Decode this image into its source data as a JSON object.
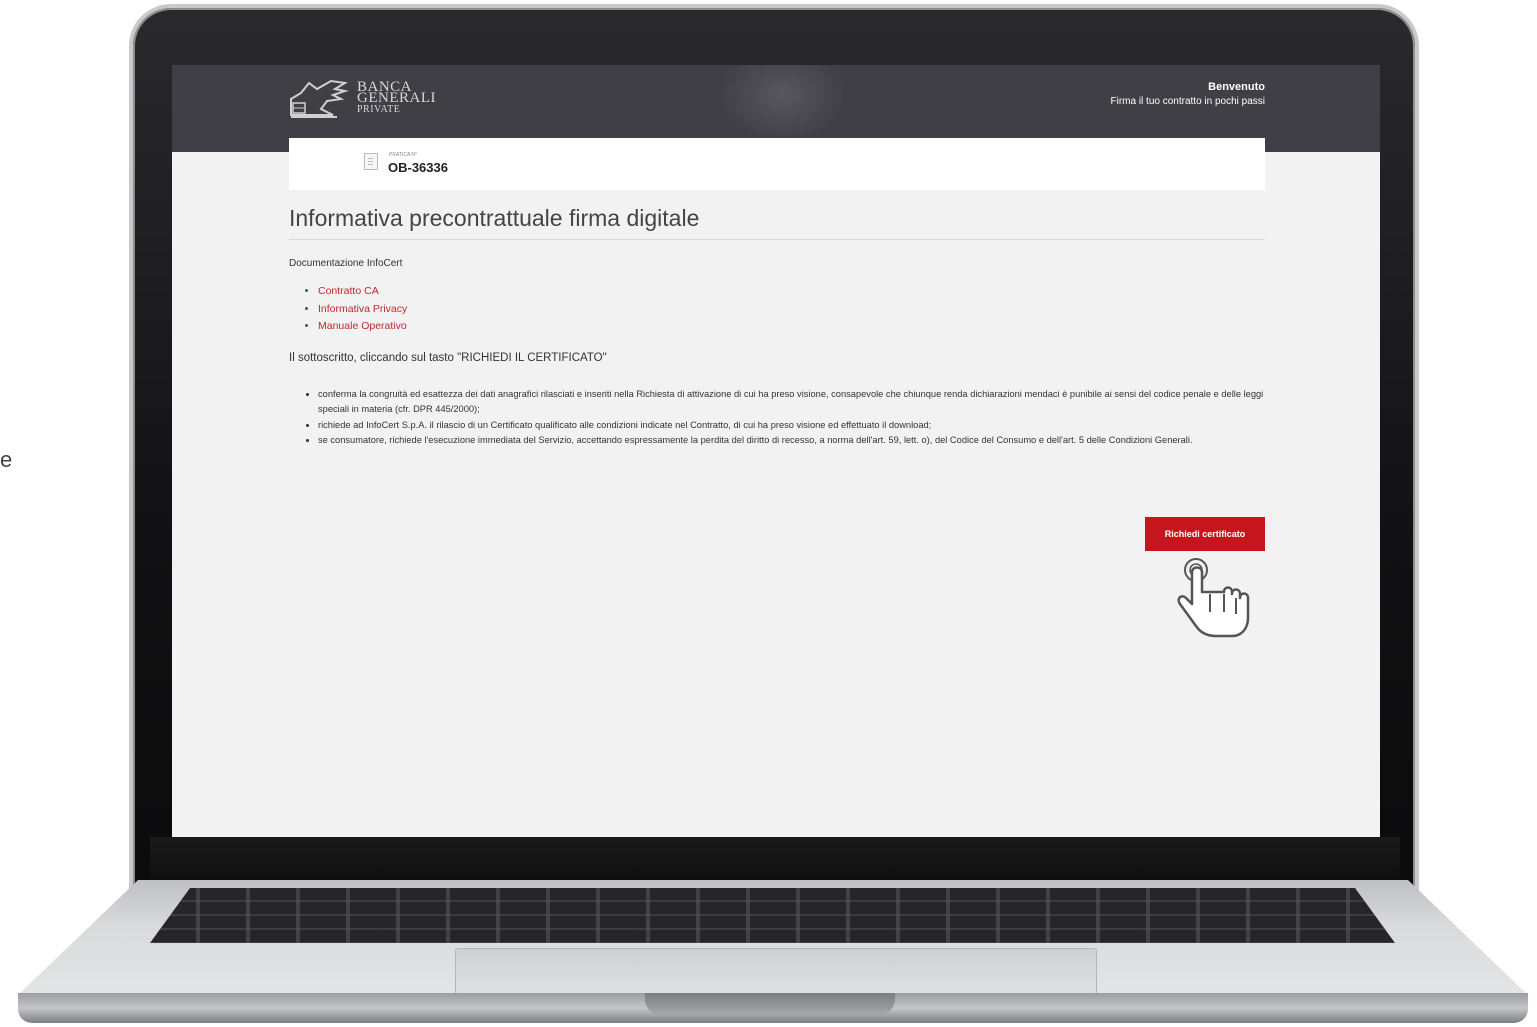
{
  "header": {
    "logo": {
      "line1": "BANCA",
      "line2": "GENERALI",
      "line3": "PRIVATE"
    },
    "welcome_title": "Benvenuto",
    "welcome_subtitle": "Firma il tuo contratto in pochi passi"
  },
  "pratica": {
    "label": "PRATICA N°",
    "number": "OB-36336"
  },
  "main": {
    "title": "Informativa precontrattuale firma digitale",
    "doc_heading": "Documentazione InfoCert",
    "doc_links": [
      "Contratto CA",
      "Informativa Privacy",
      "Manuale Operativo"
    ],
    "intro": "Il sottoscritto, cliccando sul tasto \"RICHIEDI IL CERTIFICATO\"",
    "conditions": [
      "conferma la congruità ed esattezza dei dati anagrafici rilasciati e inseriti nella Richiesta di attivazione di cui ha preso visione, consapevole che chiunque renda dichiarazioni mendaci è punibile ai sensi del codice penale e delle leggi speciali in materia (cfr. DPR 445/2000);",
      "richiede ad InfoCert S.p.A. il rilascio di un Certificato qualificato alle condizioni indicate nel Contratto, di cui ha preso visione ed effettuato il download;",
      "se consumatore, richiede l'esecuzione immediata del Servizio, accettando espressamente la perdita del diritto di recesso, a norma dell'art. 59, lett. o), del Codice del Consumo e dell'art. 5 delle Condizioni Generali."
    ],
    "cta_label": "Richiedi certificato"
  },
  "side_fragment": "e",
  "colors": {
    "brand_red": "#c4161c",
    "topbar": "#3f3f45",
    "link": "#c0282d"
  },
  "icons": [
    "logo-lion-icon",
    "document-icon",
    "tap-hand-icon"
  ]
}
